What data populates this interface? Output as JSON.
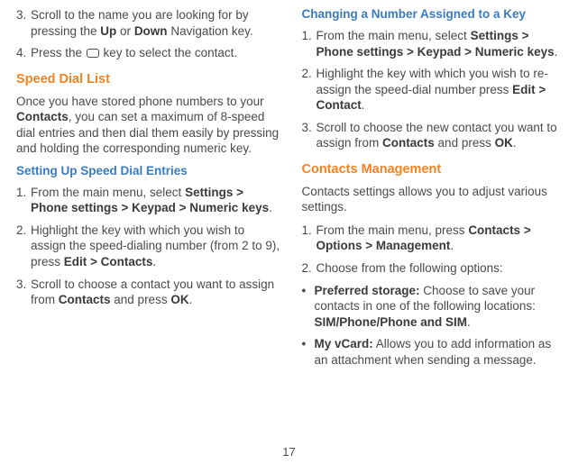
{
  "left": {
    "item3_pre": "Scroll to the name you are looking for by pressing the ",
    "item3_up": "Up",
    "item3_mid": " or ",
    "item3_down": "Down",
    "item3_post": " Navigation key.",
    "item4_pre": "Press the ",
    "item4_post": " key to select the contact.",
    "speed_dial_heading": "Speed Dial List",
    "speed_dial_para_pre": "Once you have stored phone numbers to your ",
    "speed_dial_para_bold": "Contacts",
    "speed_dial_para_post": ", you can set a maximum of 8-speed dial entries and then dial them easily by pressing and holding the corresponding numeric key.",
    "setting_up_heading": "Setting Up Speed Dial Entries",
    "s1_pre": "From the main menu, select ",
    "s1_bold": "Settings > Phone settings > Keypad > Numeric keys",
    "s1_post": ".",
    "s2_pre": "Highlight the key with which you wish to assign the speed-dialing number (from 2 to 9), press ",
    "s2_bold": "Edit > Contacts",
    "s2_post": ".",
    "s3_pre": "Scroll to choose a contact you want to assign from ",
    "s3_bold1": "Contacts",
    "s3_mid": " and press ",
    "s3_bold2": "OK",
    "s3_post": "."
  },
  "right": {
    "change_heading": "Changing a Number Assigned to a Key",
    "c1_pre": "From the main menu, select ",
    "c1_bold": "Settings > Phone settings > Keypad > Numeric keys",
    "c1_post": ".",
    "c2_pre": "Highlight the key with which you wish to re-assign the speed-dial number press ",
    "c2_bold": "Edit > Contact",
    "c2_post": ".",
    "c3_pre": "Scroll to choose the new contact you want to assign from ",
    "c3_bold1": "Contacts",
    "c3_mid": " and press ",
    "c3_bold2": "OK",
    "c3_post": ".",
    "contacts_mgmt_heading": "Contacts Management",
    "contacts_mgmt_para": "Contacts settings allows you to adjust various settings.",
    "m1_pre": "From the main menu, press ",
    "m1_bold": "Contacts > Options > Management",
    "m1_post": ".",
    "m2": "Choose from the following options:",
    "b1_label": "Preferred storage:",
    "b1_text_pre": " Choose to save your contacts in one of the following locations: ",
    "b1_bold": "SIM/Phone/Phone and SIM",
    "b1_post": ".",
    "b2_label": "My vCard:",
    "b2_text": " Allows you to add information as an attachment when sending a message."
  },
  "page_number": "17",
  "nums": {
    "n1": "1.",
    "n2": "2.",
    "n3": "3.",
    "n4": "4."
  },
  "bullet": "•"
}
